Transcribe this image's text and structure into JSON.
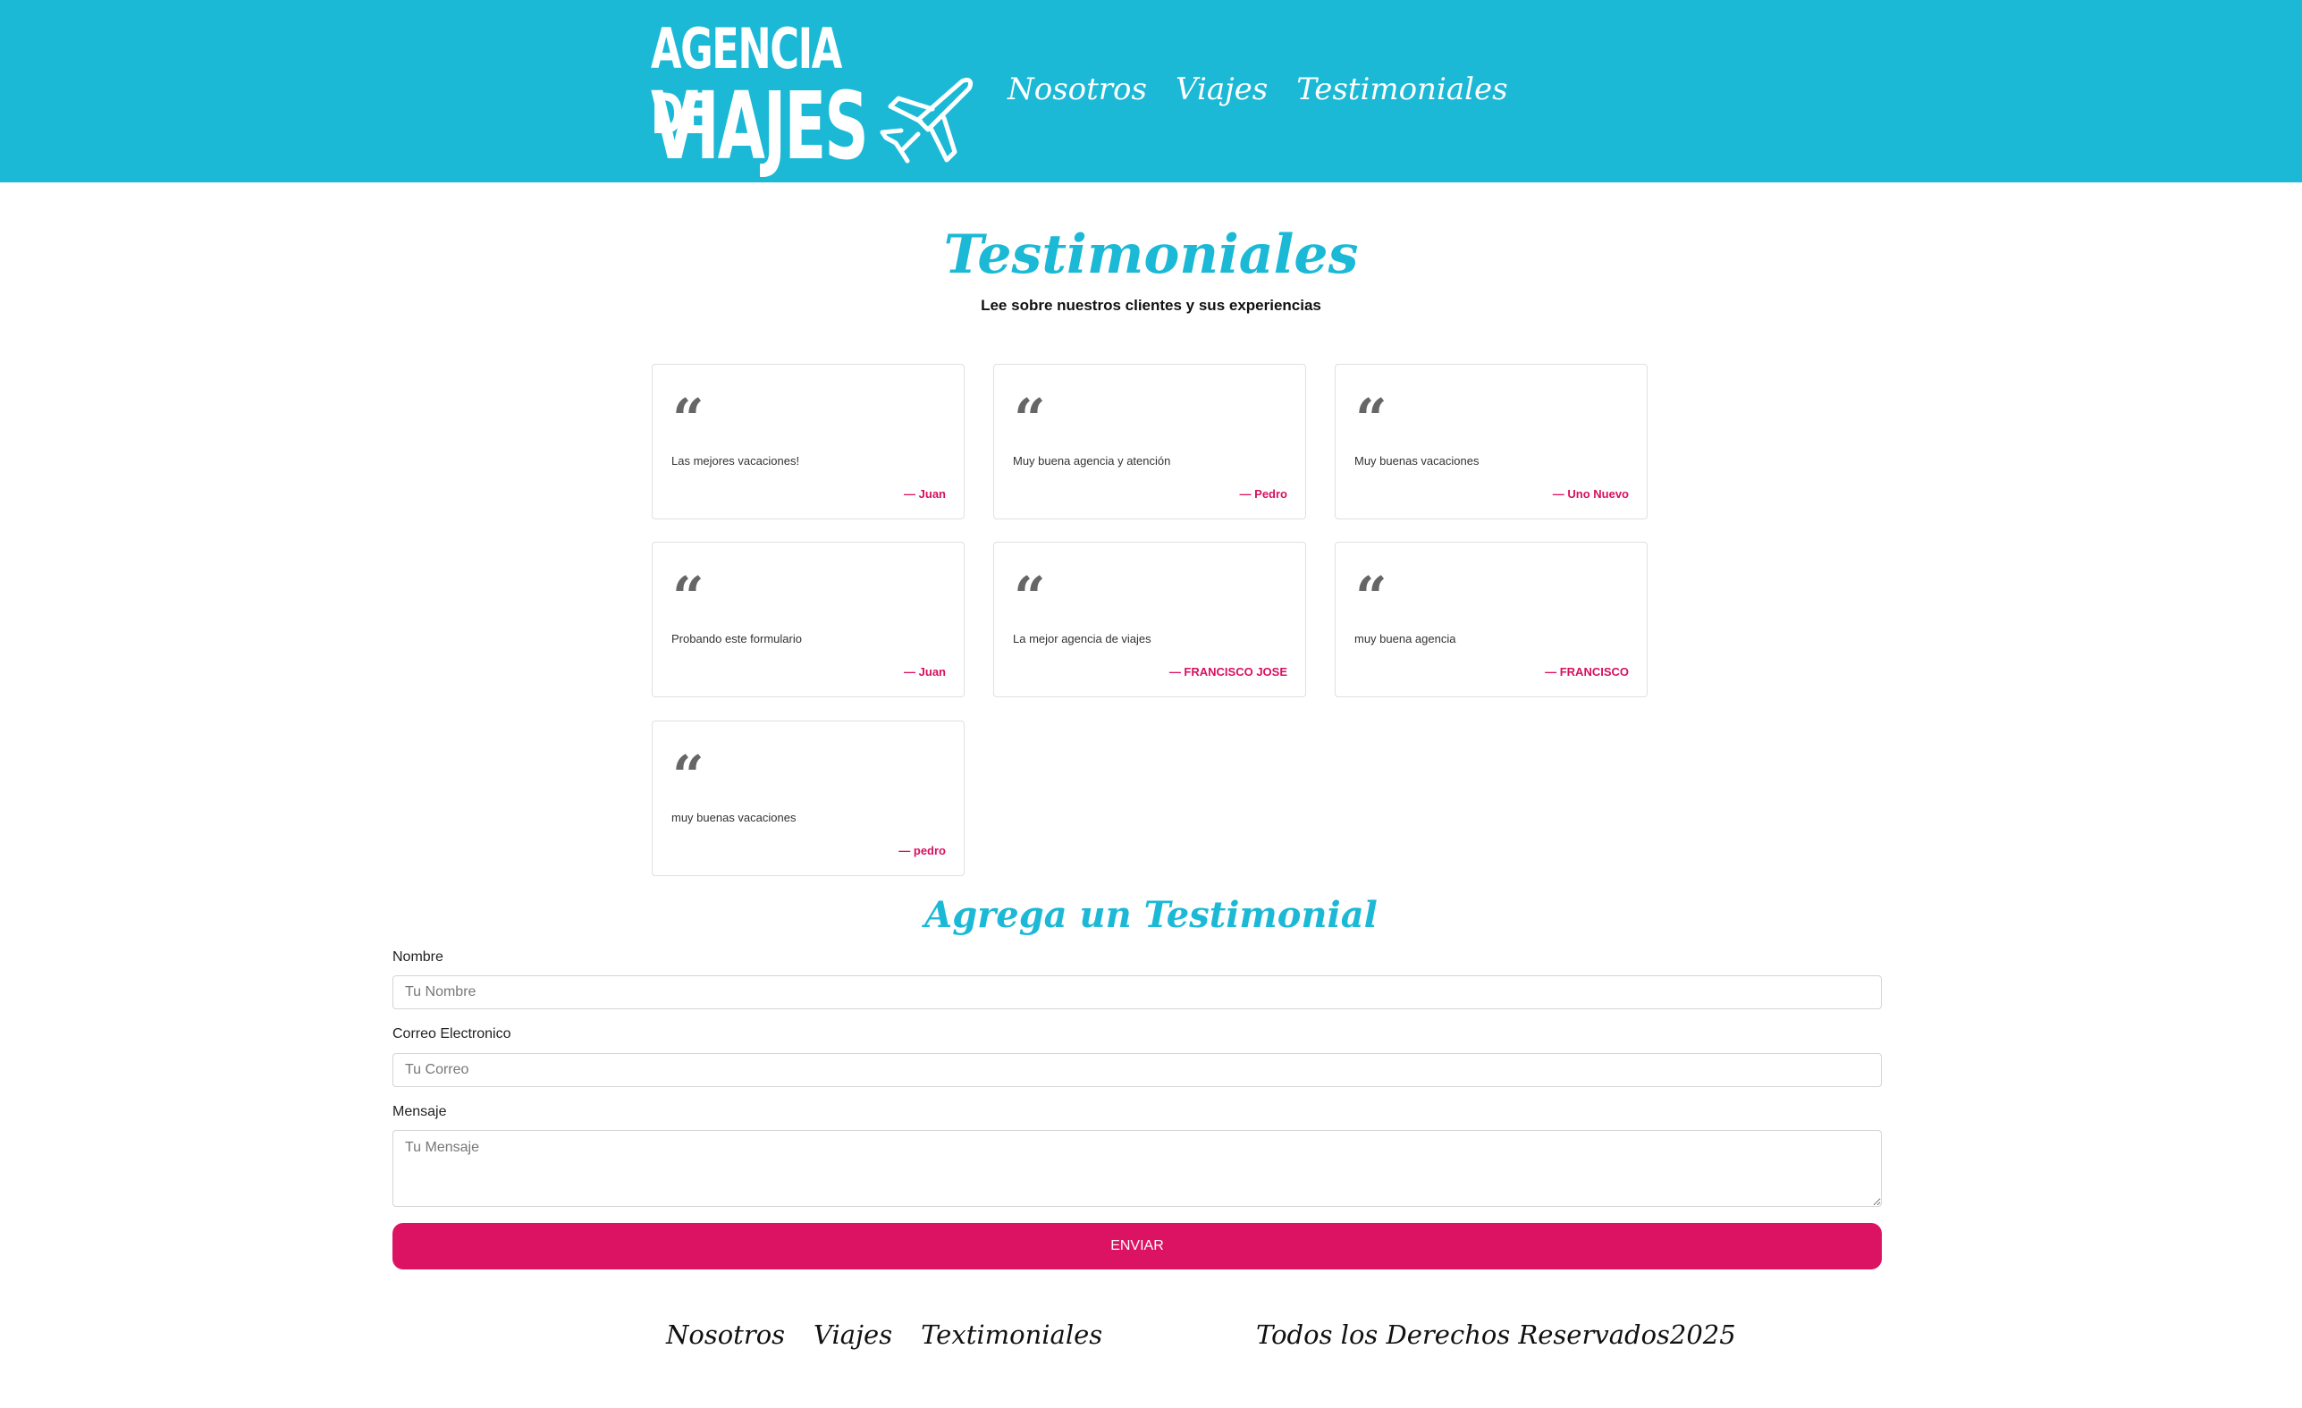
{
  "header": {
    "logo_line1": "AGENCIA DE",
    "logo_line2": "VIAJES",
    "nav": [
      "Nosotros",
      "Viajes",
      "Testimoniales"
    ]
  },
  "page": {
    "title": "Testimoniales",
    "subtitle": "Lee sobre nuestros clientes y sus experiencias"
  },
  "testimonials": [
    {
      "quote_icon": "quote-icon",
      "message": "Las mejores vacaciones!",
      "author": "— Juan"
    },
    {
      "quote_icon": "quote-icon",
      "message": "Muy buena agencia y atención",
      "author": "— Pedro"
    },
    {
      "quote_icon": "quote-icon",
      "message": "Muy buenas vacaciones",
      "author": "— Uno Nuevo"
    },
    {
      "quote_icon": "quote-icon",
      "message": "Probando este formulario",
      "author": "— Juan"
    },
    {
      "quote_icon": "quote-icon",
      "message": "La mejor agencia de viajes",
      "author": "— FRANCISCO JOSE"
    },
    {
      "quote_icon": "quote-icon",
      "message": "muy buena agencia",
      "author": "— FRANCISCO"
    },
    {
      "quote_icon": "quote-icon",
      "message": "muy buenas vacaciones",
      "author": "— pedro"
    }
  ],
  "form": {
    "title": "Agrega un Testimonial",
    "name_label": "Nombre",
    "name_placeholder": "Tu Nombre",
    "email_label": "Correo Electronico",
    "email_placeholder": "Tu Correo",
    "message_label": "Mensaje",
    "message_placeholder": "Tu Mensaje",
    "submit_label": "ENVIAR"
  },
  "footer": {
    "nav": [
      "Nosotros",
      "Viajes",
      "Textimoniales"
    ],
    "copyright": "Todos los Derechos Reservados2025"
  },
  "colors": {
    "brand": "#1bb9d6",
    "accent": "#dc1263"
  }
}
